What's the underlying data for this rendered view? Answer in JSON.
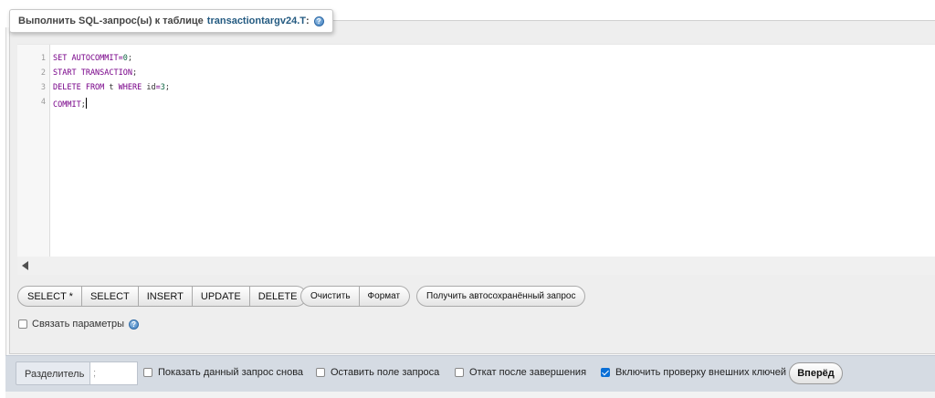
{
  "legend": {
    "prefix": "Выполнить SQL-запрос(ы) к таблице",
    "table": "transactiontargv24.T",
    "colon": ":",
    "help_icon": "help-icon"
  },
  "editor": {
    "lines": [
      {
        "number": "1",
        "parts": [
          {
            "t": "SET AUTOCOMMIT",
            "c": "kw"
          },
          {
            "t": "=",
            "c": "kw"
          },
          {
            "t": "0",
            "c": "num"
          },
          {
            "t": ";",
            "c": "punct"
          }
        ]
      },
      {
        "number": "2",
        "parts": [
          {
            "t": "START TRANSACTION",
            "c": "kw"
          },
          {
            "t": ";",
            "c": "punct"
          }
        ]
      },
      {
        "number": "3",
        "parts": [
          {
            "t": "DELETE FROM",
            "c": "kw"
          },
          {
            "t": " t ",
            "c": "punct"
          },
          {
            "t": "WHERE",
            "c": "kw"
          },
          {
            "t": " id",
            "c": "punct"
          },
          {
            "t": "=",
            "c": "kw"
          },
          {
            "t": "3",
            "c": "num"
          },
          {
            "t": ";",
            "c": "punct"
          }
        ]
      },
      {
        "number": "4",
        "parts": [
          {
            "t": "COMMIT",
            "c": "kw"
          },
          {
            "t": ";",
            "c": "punct"
          }
        ]
      }
    ],
    "colors": {
      "keyword": "#770088",
      "number": "#116644"
    }
  },
  "query_buttons": {
    "select_star": "SELECT *",
    "select": "SELECT",
    "insert": "INSERT",
    "update": "UPDATE",
    "delete": "DELETE"
  },
  "format_buttons": {
    "clear": "Очистить",
    "format": "Формат"
  },
  "autosave_button": "Получить автосохранённый запрос",
  "bind_params": {
    "label": "Связать параметры",
    "checked": false
  },
  "bottom": {
    "delimiter_label": "Разделитель",
    "delimiter_value": ";",
    "options": [
      {
        "label": "Показать данный запрос снова",
        "checked": false
      },
      {
        "label": "Оставить поле запроса",
        "checked": false
      },
      {
        "label": "Откат после завершения",
        "checked": false
      },
      {
        "label": "Включить проверку внешних ключей",
        "checked": true
      }
    ],
    "go_label": "Вперёд"
  }
}
